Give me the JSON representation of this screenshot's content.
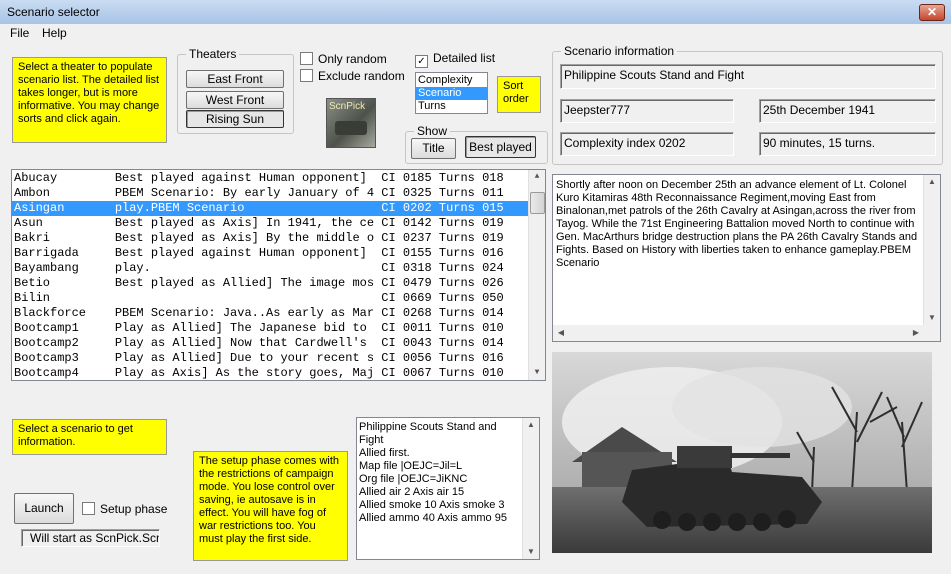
{
  "window": {
    "title": "Scenario selector",
    "close_glyph": "✕"
  },
  "menu": {
    "file": "File",
    "help": "Help"
  },
  "help_theater": "Select a theater to populate scenario list. The detailed list takes longer, but is more informative. You may change sorts and click again.",
  "theaters": {
    "legend": "Theaters",
    "buttons": [
      "East Front",
      "West Front",
      "Rising Sun"
    ],
    "selected": "Rising Sun"
  },
  "options": {
    "only_random": "Only random",
    "exclude_random": "Exclude random",
    "detailed_list": "Detailed list",
    "detailed_checked": "✓"
  },
  "sort": {
    "items": [
      "Complexity",
      "Scenario",
      "Turns"
    ],
    "selected": "Scenario",
    "label": "Sort order"
  },
  "logo_text": "ScnPick",
  "show": {
    "legend": "Show",
    "title": "Title",
    "best_played": "Best played"
  },
  "info": {
    "legend": "Scenario information",
    "name": "Philippine Scouts Stand and Fight",
    "author": "Jeepster777",
    "date": "25th December 1941",
    "complexity": "Complexity index 0202",
    "duration": "90 minutes, 15 turns."
  },
  "scenarios": [
    {
      "text": "Abucay        Best played against Human opponent]  CI 0185 Turns 018"
    },
    {
      "text": "Ambon         PBEM Scenario: By early January of 4 CI 0325 Turns 011"
    },
    {
      "text": "Asingan       play.PBEM Scenario                   CI 0202 Turns 015",
      "selected": true
    },
    {
      "text": "Asun          Best played as Axis] In 1941, the ce CI 0142 Turns 019"
    },
    {
      "text": "Bakri         Best played as Axis] By the middle o CI 0237 Turns 019"
    },
    {
      "text": "Barrigada     Best played against Human opponent]  CI 0155 Turns 016"
    },
    {
      "text": "Bayambang     play.                                CI 0318 Turns 024"
    },
    {
      "text": "Betio         Best played as Allied] The image mos CI 0479 Turns 026"
    },
    {
      "text": "Bilin                                              CI 0669 Turns 050"
    },
    {
      "text": "Blackforce    PBEM Scenario: Java..As early as Mar CI 0268 Turns 014"
    },
    {
      "text": "Bootcamp1     Play as Allied] The Japanese bid to  CI 0011 Turns 010"
    },
    {
      "text": "Bootcamp2     Play as Allied] Now that Cardwell's  CI 0043 Turns 014"
    },
    {
      "text": "Bootcamp3     Play as Allied] Due to your recent s CI 0056 Turns 016"
    },
    {
      "text": "Bootcamp4     Play as Axis] As the story goes, Maj CI 0067 Turns 010"
    }
  ],
  "description": "Shortly after noon on December 25th an advance element of Lt. Colonel Kuro Kitamiras 48th Reconnaissance Regiment,moving East from Binalonan,met patrols of the 26th Cavalry at Asingan,across the river from Tayog. While the 71st Engineering Battalion moved North to continue with Gen. MacArthurs bridge destruction plans the PA 26th Cavalry Stands and Fights. Based on History with liberties taken to enhance gameplay.PBEM Scenario",
  "help_scenario": "Select a scenario to get information.",
  "help_setup": "The setup phase comes with the restrictions of campaign mode. You lose control over saving, ie autosave is in effect.  You will have fog of war restrictions too. You must play the first side.",
  "details": [
    "Philippine Scouts Stand and Fight",
    "Allied first.",
    "Map file |OEJC=Jil=L",
    "Org file |OEJC=JiKNC",
    "Allied air 2 Axis air 15",
    "Allied smoke 10 Axis smoke 3",
    "Allied ammo 40 Axis ammo 95"
  ],
  "launch": {
    "label": "Launch",
    "setup_phase": "Setup phase",
    "status": "Will start as ScnPick.Scn"
  },
  "arrows": {
    "up": "▲",
    "down": "▼",
    "left": "◀",
    "right": "▶"
  }
}
